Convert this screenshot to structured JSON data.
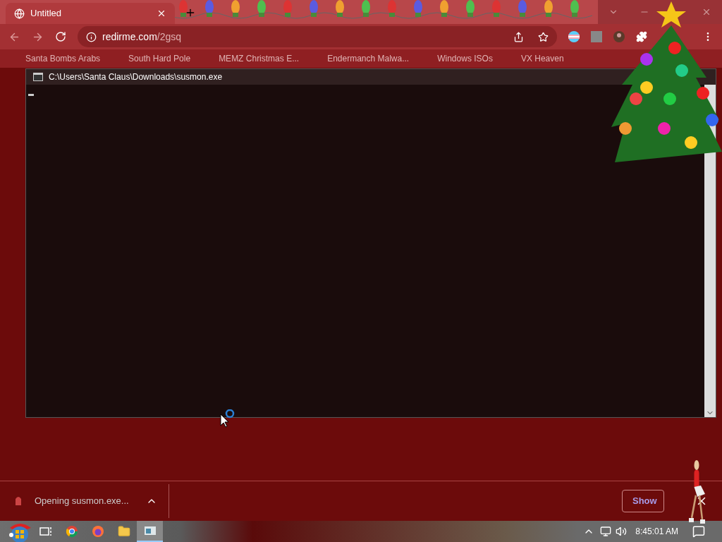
{
  "browser": {
    "tabs": [
      {
        "title": "Untitled",
        "selected": true
      }
    ],
    "address": {
      "host": "redirme.com",
      "path": "/2gsq"
    },
    "bookmarks": [
      "Santa Bombs Arabs",
      "South Hard Pole",
      "MEMZ Christmas E...",
      "Endermanch Malwa...",
      "Windows ISOs",
      "VX Heaven"
    ]
  },
  "console": {
    "title": "C:\\Users\\Santa Claus\\Downloads\\susmon.exe"
  },
  "download_bar": {
    "item": "Opening susmon.exe...",
    "button": "Show"
  },
  "taskbar": {
    "apps": [
      {
        "kind": "taskview",
        "selected": false
      },
      {
        "kind": "chrome",
        "selected": false
      },
      {
        "kind": "firefox",
        "selected": false
      },
      {
        "kind": "explorer",
        "selected": false
      },
      {
        "kind": "console",
        "selected": true
      }
    ],
    "clock": "8:45:01 AM"
  }
}
